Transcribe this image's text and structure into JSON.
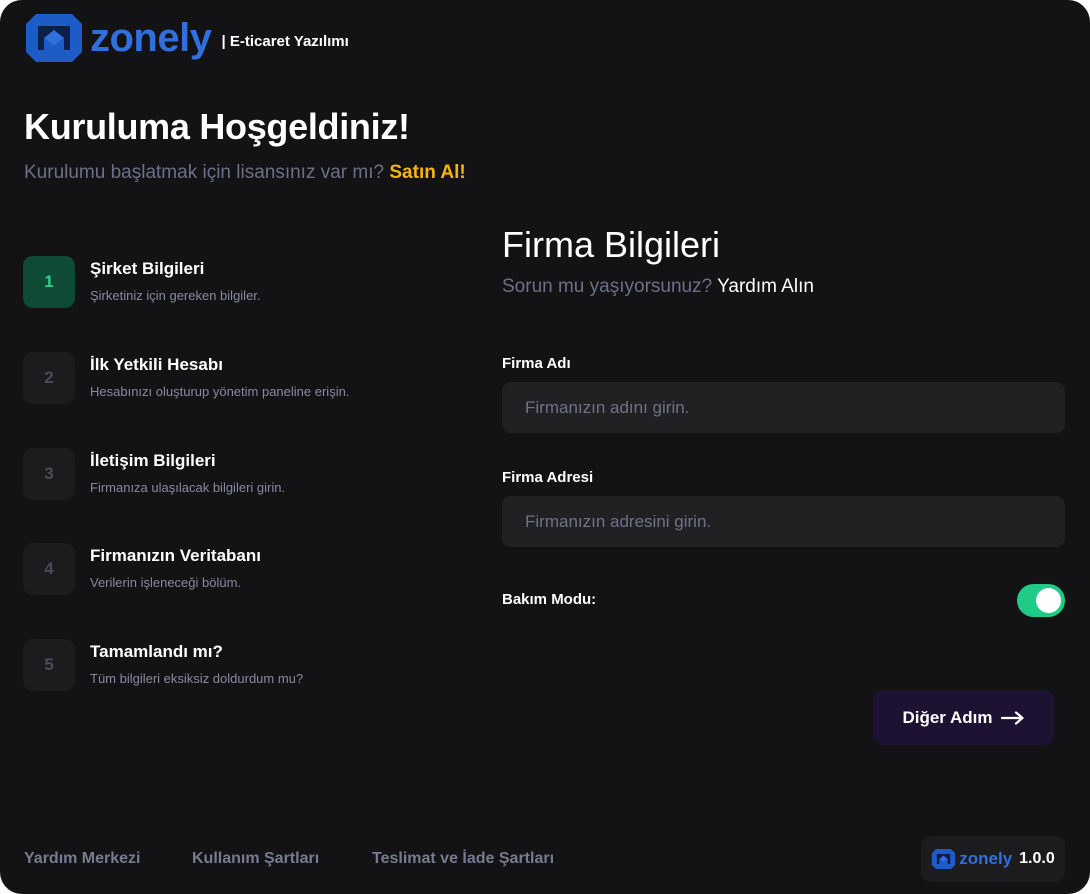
{
  "brand": {
    "name": "zonely",
    "tagline": "| E-ticaret Yazılımı",
    "color": "#2f6fde"
  },
  "welcome": {
    "title": "Kuruluma Hoşgeldiniz!",
    "subtitle": "Kurulumu başlatmak için lisansınız var mı?",
    "buy_link": "Satın Al!",
    "buy_color": "#f5b50a"
  },
  "steps": [
    {
      "number": "1",
      "title": "Şirket Bilgileri",
      "description": "Şirketiniz için gereken bilgiler.",
      "active": true
    },
    {
      "number": "2",
      "title": "İlk Yetkili Hesabı",
      "description": "Hesabınızı oluşturup yönetim paneline erişin.",
      "active": false
    },
    {
      "number": "3",
      "title": "İletişim Bilgileri",
      "description": "Firmanıza ulaşılacak bilgileri girin.",
      "active": false
    },
    {
      "number": "4",
      "title": "Firmanızın Veritabanı",
      "description": "Verilerin işleneceği bölüm.",
      "active": false
    },
    {
      "number": "5",
      "title": "Tamamlandı mı?",
      "description": "Tüm bilgileri eksiksiz doldurdum mu?",
      "active": false
    }
  ],
  "form": {
    "title": "Firma Bilgileri",
    "help_text": "Sorun mu yaşıyorsunuz?",
    "help_link": "Yardım Alın",
    "company_name": {
      "label": "Firma Adı",
      "placeholder": "Firmanızın adını girin.",
      "value": ""
    },
    "company_address": {
      "label": "Firma Adresi",
      "placeholder": "Firmanızın adresini girin.",
      "value": ""
    },
    "maintenance": {
      "label": "Bakım Modu:",
      "enabled": true,
      "color": "#1fcb85"
    },
    "next_button": "Diğer Adım"
  },
  "footer": {
    "links": [
      "Yardım Merkezi",
      "Kullanım Şartları",
      "Teslimat ve İade Şartları"
    ],
    "version_brand": "zonely",
    "version": "1.0.0"
  }
}
